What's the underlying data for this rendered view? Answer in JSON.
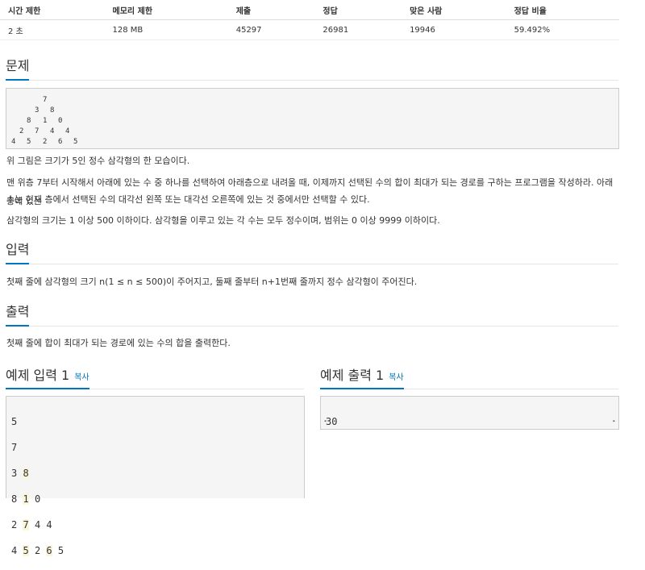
{
  "stats": {
    "headers": [
      "시간 제한",
      "메모리 제한",
      "제출",
      "정답",
      "맞은 사람",
      "정답 비율"
    ],
    "values": [
      "2 초",
      "128 MB",
      "45297",
      "26981",
      "19946",
      "59.492%"
    ]
  },
  "problem": {
    "title": "문제",
    "triangle": [
      [
        "7"
      ],
      [
        "3",
        "8"
      ],
      [
        "8",
        "1",
        "0"
      ],
      [
        "2",
        "7",
        "4",
        "4"
      ],
      [
        "4",
        "5",
        "2",
        "6",
        "5"
      ]
    ],
    "p1": "위 그림은 크기가 5인 정수 삼각형의 한 모습이다.",
    "p2a": "맨 위층 7부터 시작해서 아래에 있는 수 중 하나를 선택하여 아래층으로 내려올 때, 이제까지 선택된 수의 합이 최대가 되는 경로를 구하는 프로그램을 작성하라. 아래층에 있는",
    "p2b": "수는 현재 층에서 선택된 수의 대각선 왼쪽 또는 대각선 오른쪽에 있는 것 중에서만 선택할 수 있다.",
    "p3": "삼각형의 크기는 1 이상 500 이하이다. 삼각형을 이루고 있는 각 수는 모두 정수이며, 범위는 0 이상 9999 이하이다."
  },
  "input": {
    "title": "입력",
    "text": "첫째 줄에 삼각형의 크기 n(1 ≤ n ≤ 500)이 주어지고, 둘째 줄부터 n+1번째 줄까지 정수 삼각형이 주어진다."
  },
  "output": {
    "title": "출력",
    "text": "첫째 줄에 합이 최대가 되는 경로에 있는 수의 합을 출력한다."
  },
  "sample_input": {
    "title": "예제 입력 1",
    "copy": "복사",
    "lines": [
      [
        "5"
      ],
      [
        "7"
      ],
      [
        "3",
        "8"
      ],
      [
        "8",
        "1",
        "0"
      ],
      [
        "2",
        "7",
        "4",
        "4"
      ],
      [
        "4",
        "5",
        "2",
        "6",
        "5"
      ]
    ]
  },
  "sample_output": {
    "title": "예제 출력 1",
    "copy": "복사",
    "text": "30"
  }
}
